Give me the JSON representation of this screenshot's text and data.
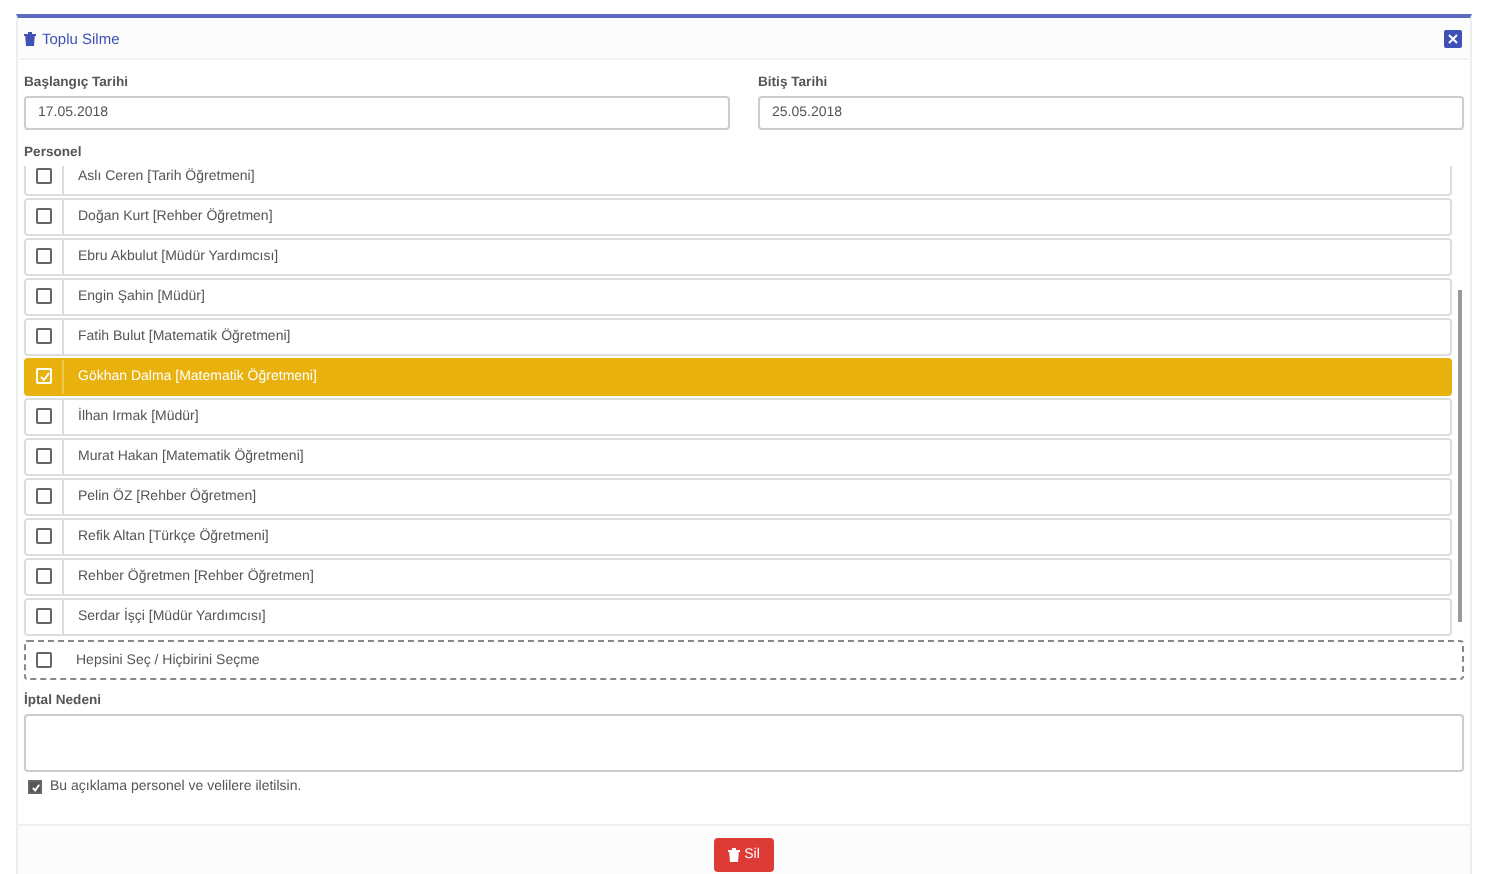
{
  "window": {
    "title": "Toplu Silme"
  },
  "start_date": {
    "label": "Başlangıç Tarihi",
    "value": "17.05.2018"
  },
  "end_date": {
    "label": "Bitiş Tarihi",
    "value": "25.05.2018"
  },
  "personnel": {
    "label": "Personel",
    "items": [
      {
        "label": "Aslı Ceren [Tarih Öğretmeni]",
        "selected": false
      },
      {
        "label": "Doğan Kurt [Rehber Öğretmen]",
        "selected": false
      },
      {
        "label": "Ebru Akbulut [Müdür Yardımcısı]",
        "selected": false
      },
      {
        "label": "Engin Şahin [Müdür]",
        "selected": false
      },
      {
        "label": "Fatih Bulut [Matematik Öğretmeni]",
        "selected": false
      },
      {
        "label": "Gökhan Dalma [Matematik Öğretmeni]",
        "selected": true
      },
      {
        "label": "İlhan Irmak [Müdür]",
        "selected": false
      },
      {
        "label": "Murat Hakan [Matematik Öğretmeni]",
        "selected": false
      },
      {
        "label": "Pelin ÖZ [Rehber Öğretmen]",
        "selected": false
      },
      {
        "label": "Refik Altan [Türkçe Öğretmeni]",
        "selected": false
      },
      {
        "label": "Rehber Öğretmen [Rehber Öğretmen]",
        "selected": false
      },
      {
        "label": "Serdar İşçi [Müdür Yardımcısı]",
        "selected": false
      }
    ],
    "select_all": {
      "label": "Hepsini Seç / Hiçbirini Seçme",
      "checked": false
    }
  },
  "reason": {
    "label": "İptal Nedeni"
  },
  "notify": {
    "label": "Bu açıklama personel ve velilere iletilsin.",
    "checked": true
  },
  "delete_button": {
    "label": "Sil"
  }
}
